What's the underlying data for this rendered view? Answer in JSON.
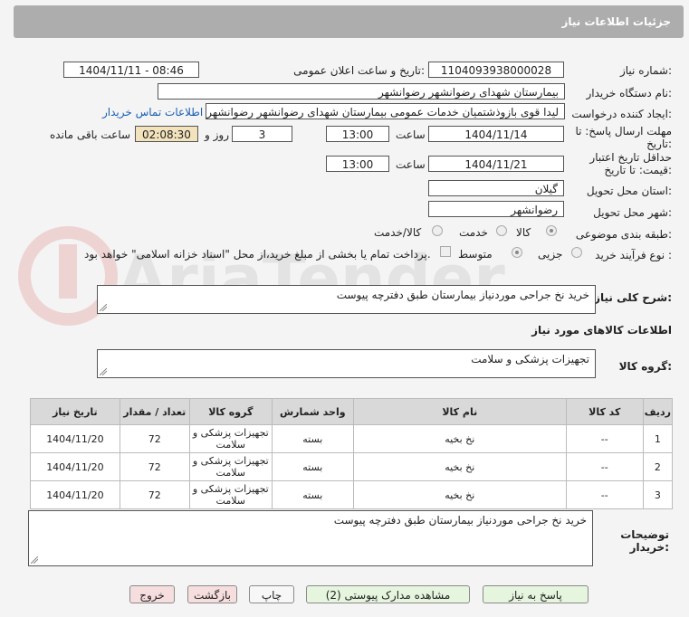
{
  "header": {
    "title": "جزئیات اطلاعات نیاز"
  },
  "form": {
    "need_number_label": "شماره نیاز:",
    "need_number": "1104093938000028",
    "announce_label": "تاریخ و ساعت اعلان عمومی:",
    "announce_value": "1404/11/11 - 08:46",
    "buyer_org_label": "نام دستگاه خریدار:",
    "buyer_org": "بیمارستان شهدای رضوانشهر رضوانشهر",
    "requester_label": "ایجاد کننده درخواست:",
    "requester": "لیدا قوی بازوذشتمیان خدمات عمومی بیمارستان شهدای رضوانشهر رضوانشهر",
    "contact_link": "اطلاعات تماس خریدار",
    "deadline_label_1": "مهلت ارسال پاسخ: تا",
    "deadline_label_2": "تاریخ:",
    "deadline_date": "1404/11/14",
    "hour_label": "ساعت",
    "deadline_time": "13:00",
    "days_value": "3",
    "days_label": "روز و",
    "remaining_time": "02:08:30",
    "remaining_label": "ساعت باقی مانده",
    "validity_label_1": "حداقل تاریخ اعتبار",
    "validity_label_2": "قیمت: تا تاریخ:",
    "validity_date": "1404/11/21",
    "validity_time": "13:00",
    "province_label": "استان محل تحویل:",
    "province": "گیلان",
    "city_label": "شهر محل تحویل:",
    "city": "رضوانشهر",
    "category_label": "طبقه بندی موضوعی:",
    "category_options": [
      "کالا",
      "خدمت",
      "کالا/خدمت"
    ],
    "process_label": "نوع فرآیند خرید :",
    "process_options": [
      "جزیی",
      "متوسط"
    ],
    "payment_note": "پرداخت تمام یا بخشی از مبلغ خرید،از محل \"اسناد خزانه اسلامی\" خواهد بود.",
    "description_label": "شرح کلی نیاز:",
    "description": "خرید نخ جراحی موردنیاز بیمارستان طبق دفترچه پیوست",
    "goods_info_title": "اطلاعات کالاهای مورد نیاز",
    "goods_group_label": "گروه کالا:",
    "goods_group": "تجهیزات پزشکی و سلامت",
    "buyer_notes_label_1": "توضیحات",
    "buyer_notes_label_2": "خریدار:",
    "buyer_notes": "خرید نخ جراحی موردنیاز بیمارستان طبق دفترچه پیوست"
  },
  "table": {
    "headers": [
      "ردیف",
      "کد کالا",
      "نام کالا",
      "واحد شمارش",
      "گروه کالا",
      "تعداد / مقدار",
      "تاریخ نیاز"
    ],
    "rows": [
      {
        "row": "1",
        "code": "--",
        "name": "نخ بخیه",
        "unit": "بسته",
        "group_1": "تجهیزات پزشکی و",
        "group_2": "سلامت",
        "qty": "72",
        "date": "1404/11/20"
      },
      {
        "row": "2",
        "code": "--",
        "name": "نخ بخیه",
        "unit": "بسته",
        "group_1": "تجهیزات پزشکی و",
        "group_2": "سلامت",
        "qty": "72",
        "date": "1404/11/20"
      },
      {
        "row": "3",
        "code": "--",
        "name": "نخ بخیه",
        "unit": "بسته",
        "group_1": "تجهیزات پزشکی و",
        "group_2": "سلامت",
        "qty": "72",
        "date": "1404/11/20"
      }
    ]
  },
  "buttons": {
    "reply": "پاسخ به نیاز",
    "view_docs": "مشاهده مدارک پیوستی (2)",
    "print": "چاپ",
    "back": "بازگشت",
    "exit": "خروج"
  },
  "watermark": {
    "text": "AriaTender.net"
  },
  "colors": {
    "header_bg": "#adadad",
    "link": "#1a5fb4",
    "highlight": "#f3e3bc",
    "button_green": "#e6f5de",
    "button_pink": "#f7dede"
  }
}
